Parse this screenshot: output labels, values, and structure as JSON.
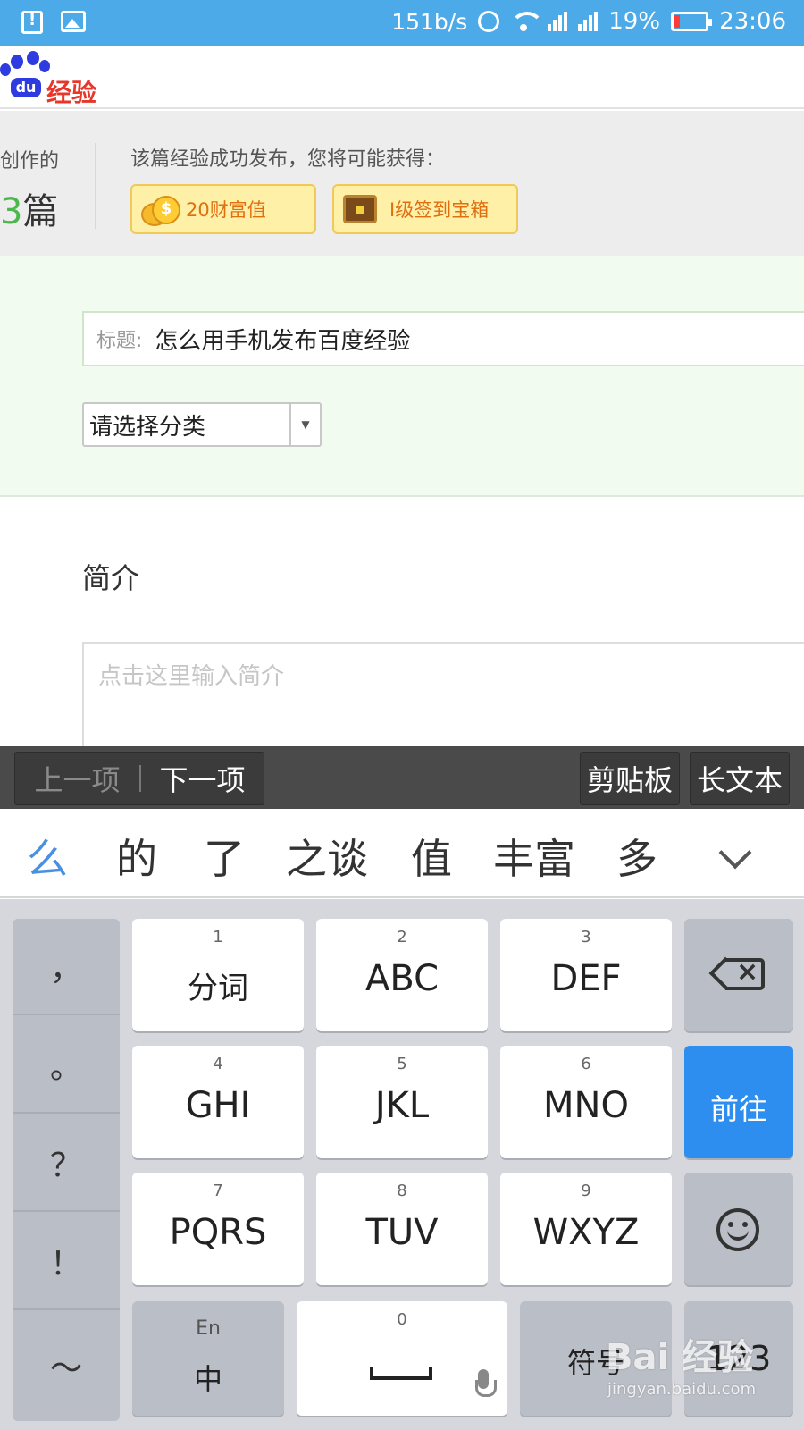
{
  "status_bar": {
    "net_speed": "151b/s",
    "battery": "19%",
    "time": "23:06",
    "battery_color": "#ff3a3a"
  },
  "header": {
    "logo_du": "du",
    "logo_brand": "经验"
  },
  "stats": {
    "created_label": "创作的",
    "count_num": "3",
    "count_unit": "篇",
    "reward_title": "该篇经验成功发布，您将可能获得：",
    "rewards": [
      {
        "label": "20财富值",
        "icon": "coin-icon"
      },
      {
        "label": "Ⅰ级签到宝箱",
        "icon": "chest-icon"
      }
    ]
  },
  "form": {
    "title_label": "标题:",
    "title_value": "怎么用手机发布百度经验",
    "category_placeholder": "请选择分类",
    "intro_label": "简介",
    "intro_placeholder": "点击这里输入简介"
  },
  "toolbar": {
    "prev": "上一项",
    "next": "下一项",
    "clipboard": "剪贴板",
    "long_text": "长文本"
  },
  "candidates": [
    "么",
    "的",
    "了",
    "之谈",
    "值",
    "丰富",
    "多"
  ],
  "keyboard": {
    "punct": [
      "，",
      "。",
      "？",
      "！",
      "～"
    ],
    "keys": [
      {
        "digit": "1",
        "label": "分词"
      },
      {
        "digit": "2",
        "label": "ABC"
      },
      {
        "digit": "3",
        "label": "DEF"
      },
      {
        "digit": "4",
        "label": "GHI"
      },
      {
        "digit": "5",
        "label": "JKL"
      },
      {
        "digit": "6",
        "label": "MNO"
      },
      {
        "digit": "7",
        "label": "PQRS"
      },
      {
        "digit": "8",
        "label": "TUV"
      },
      {
        "digit": "9",
        "label": "WXYZ"
      }
    ],
    "go_label": "前往",
    "lang_top": "En",
    "lang_bottom": "中",
    "space_digit": "0",
    "symbol_label": "符号",
    "num_label": "123",
    "accent_color": "#2d8ef0"
  },
  "watermark": {
    "logo": "Bai 经验",
    "url": "jingyan.baidu.com"
  }
}
